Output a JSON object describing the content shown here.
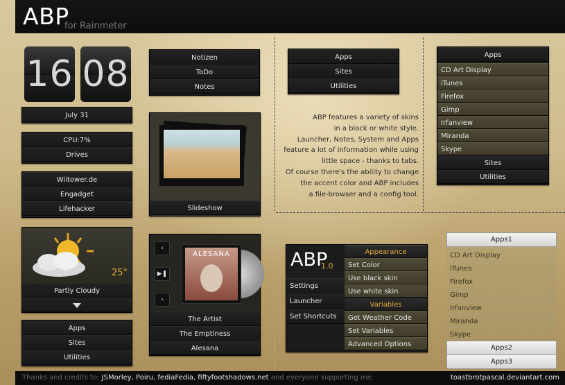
{
  "header": {
    "title": "ABP",
    "subtitle": "for Rainmeter"
  },
  "clock": {
    "hours": "16",
    "minutes": "08",
    "date": "July  31"
  },
  "system": {
    "cpu": "CPU:7%",
    "drives": "Drives"
  },
  "links": [
    "Wiitower.de",
    "Engadget",
    "Lifehacker"
  ],
  "weather": {
    "temp": "25°",
    "condition": "Partly Cloudy"
  },
  "launcher_small": [
    "Apps",
    "Sites",
    "Utilities"
  ],
  "notes_menu": [
    "Notizen",
    "ToDo",
    "Notes"
  ],
  "slideshow": {
    "label": "Slideshow"
  },
  "music": {
    "art_text": "ALESANA",
    "artist": "The Artist",
    "track": "The Emptiness",
    "album": "Alesana"
  },
  "launcher_mid": [
    "Apps",
    "Sites",
    "Utilities"
  ],
  "description": [
    "ABP features a variety of skins",
    "in a black or white style.",
    "Launcher, Notes, System and Apps",
    "feature a lot of information while using",
    "little space - thanks to tabs.",
    "Of course there's the ability to change",
    "the accent color and ABP includes",
    "a file-browser and a config tool."
  ],
  "apps_dark": {
    "header": "Apps",
    "items": [
      "CD Art Display",
      "iTunes",
      "Firefox",
      "Gimp",
      "Irfanview",
      "Miranda",
      "Skype"
    ],
    "footer": [
      "Sites",
      "Utilities"
    ]
  },
  "config": {
    "logo": "ABP",
    "version": "1.0",
    "left_menu": [
      "Settings",
      "Launcher",
      "Set Shortcuts"
    ],
    "appearance_header": "Appearance",
    "appearance": [
      "Set Color",
      "Use black skin",
      "Use white skin"
    ],
    "variables_header": "Variables",
    "variables": [
      "Get Weather Code",
      "Set Variables",
      "Advanced Options"
    ]
  },
  "apps_light": {
    "header": "Apps1",
    "items": [
      "CD Art Display",
      "iTunes",
      "Firefox",
      "Gimp",
      "Irfanview",
      "Miranda",
      "Skype"
    ],
    "footer": [
      "Apps2",
      "Apps3"
    ]
  },
  "footer": {
    "prefix": "Thanks and credits to:",
    "names": "JSMorley, Poiru, fediaFedia, fiftyfootshadows.net",
    "suffix": "and everyone supporting me.",
    "url": "toastbrotpascal.deviantart.com"
  },
  "colors": {
    "accent": "#e0a93a",
    "panel": "#1c1c1c",
    "olive": "#4a4532"
  }
}
